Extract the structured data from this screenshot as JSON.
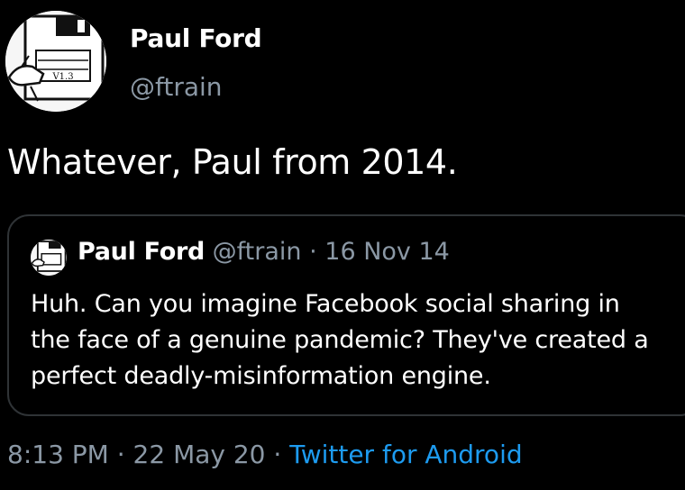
{
  "author": {
    "display_name": "Paul Ford",
    "handle": "@ftrain",
    "avatar_icon": "floppy-disk-drawing-icon"
  },
  "tweet": {
    "text": "Whatever, Paul from 2014."
  },
  "quoted_tweet": {
    "display_name": "Paul Ford",
    "handle": "@ftrain",
    "separator": "·",
    "date": "16 Nov 14",
    "lines": [
      "Huh. Can you imagine Facebook social sharing in",
      "the face of a genuine pandemic? They've created a",
      "perfect deadly-misinformation engine."
    ]
  },
  "meta": {
    "time": "8:13 PM",
    "sep1": "·",
    "date": "22 May 20",
    "sep2": "·",
    "source": "Twitter for Android"
  },
  "colors": {
    "background": "#000000",
    "text_primary": "#ffffff",
    "text_secondary": "#8b98a5",
    "link": "#1d9bf0",
    "border": "#2f3336"
  }
}
